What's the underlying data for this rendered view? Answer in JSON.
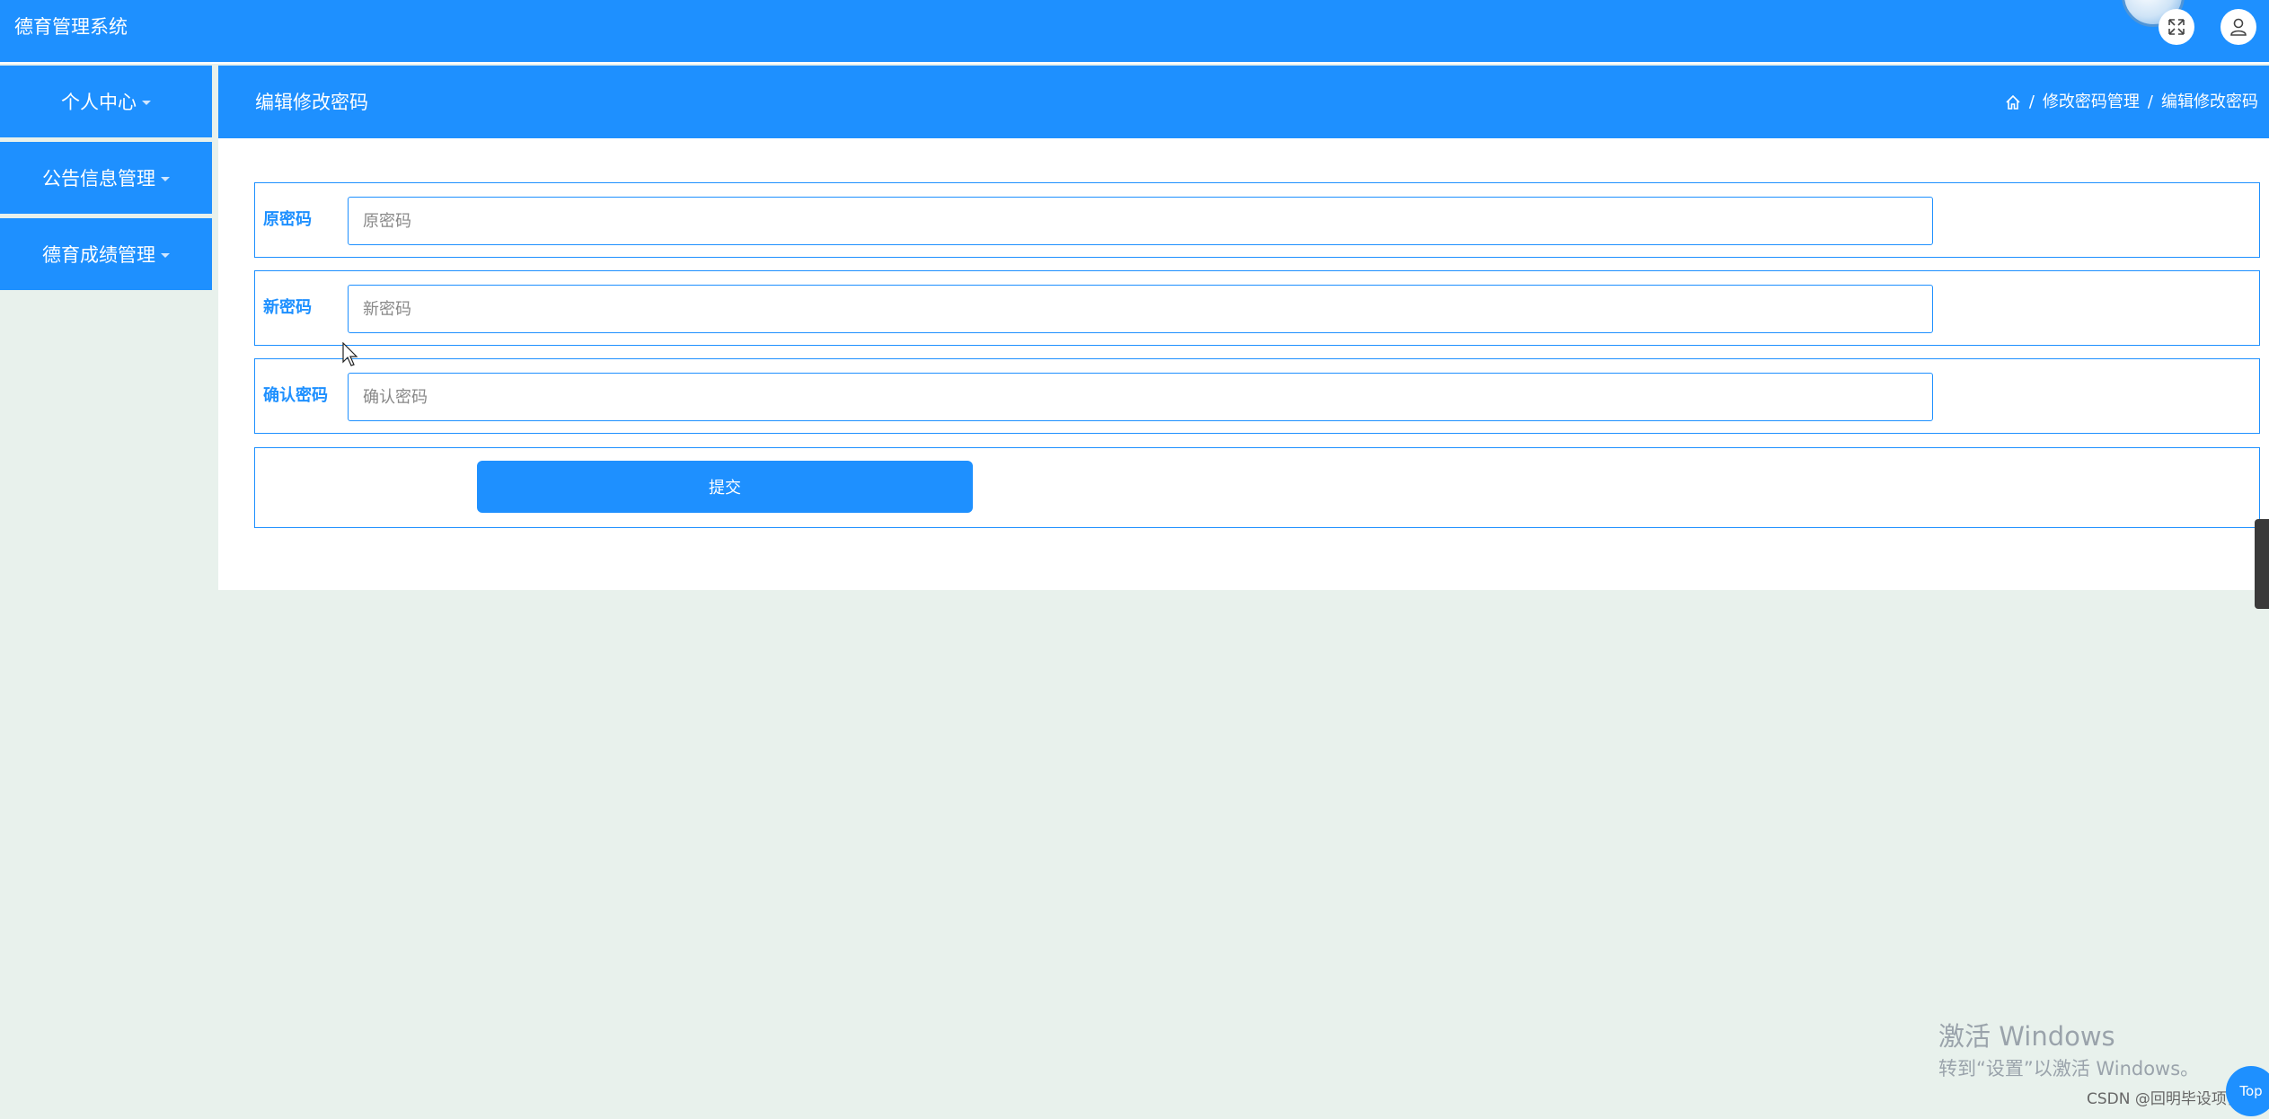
{
  "app": {
    "title": "德育管理系统"
  },
  "sidebar": {
    "items": [
      {
        "label": "个人中心"
      },
      {
        "label": "公告信息管理"
      },
      {
        "label": "德育成绩管理"
      }
    ]
  },
  "header": {
    "page_title": "编辑修改密码",
    "breadcrumb": [
      "修改密码管理",
      "编辑修改密码"
    ]
  },
  "form": {
    "old_password": {
      "label": "原密码",
      "placeholder": "原密码",
      "value": ""
    },
    "new_password": {
      "label": "新密码",
      "placeholder": "新密码",
      "value": ""
    },
    "confirm_password": {
      "label": "确认密码",
      "placeholder": "确认密码",
      "value": ""
    },
    "submit_label": "提交"
  },
  "overlay": {
    "watermark_line1": "激活 Windows",
    "watermark_line2": "转到“设置”以激活 Windows。",
    "csdn_credit": "CSDN @回明毕设项目",
    "back_to_top": "Top"
  },
  "colors": {
    "primary": "#1e90ff",
    "background": "#e8f1ec",
    "panel": "#ffffff"
  }
}
